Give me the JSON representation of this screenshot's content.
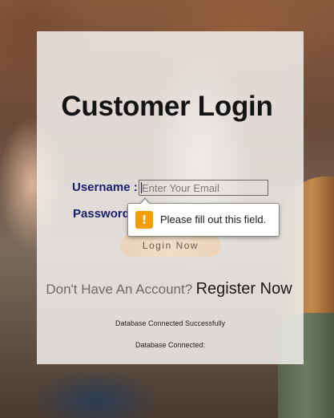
{
  "page": {
    "title": "Customer Login"
  },
  "form": {
    "username_label": "Username :",
    "password_label": "Password",
    "username_placeholder": "Enter Your Email",
    "login_button": "Login Now"
  },
  "validation_tooltip": {
    "icon": "warning-icon",
    "icon_glyph": "!",
    "message": "Please fill out this field.",
    "icon_color": "#f59c00"
  },
  "signup": {
    "question": "Don't Have An Account?",
    "link_text": "Register Now"
  },
  "status": {
    "message_1": "Database Connected Successfully",
    "message_2": "Database Connected:"
  },
  "colors": {
    "label_color": "#1a1f6e",
    "title_color": "#141414"
  }
}
